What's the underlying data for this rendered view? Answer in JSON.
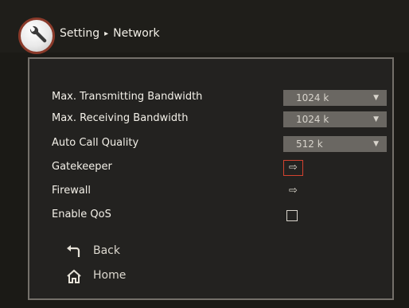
{
  "header": {
    "icon": "wrench-icon",
    "breadcrumb": [
      "Setting",
      "Network"
    ],
    "separator": "▸"
  },
  "settings": [
    {
      "label": "Max. Transmitting Bandwidth",
      "control": "select",
      "value": "1024 k"
    },
    {
      "label": "Max. Receiving Bandwidth",
      "control": "select",
      "value": "1024 k"
    },
    {
      "label": "Auto Call Quality",
      "control": "select",
      "value": "512 k"
    },
    {
      "label": "Gatekeeper",
      "control": "arrow",
      "value": "⇨",
      "focused": true
    },
    {
      "label": "Firewall",
      "control": "arrow",
      "value": "⇨",
      "focused": false
    },
    {
      "label": "Enable QoS",
      "control": "checkbox",
      "checked": false
    }
  ],
  "nav": {
    "back": {
      "label": "Back",
      "icon": "back-arrow-icon"
    },
    "home": {
      "label": "Home",
      "icon": "home-icon"
    }
  },
  "colors": {
    "background": "#1b1a16",
    "panel_border": "#74706a",
    "select_bg": "#6a6762",
    "focus_border": "#d3422f",
    "logo_ring": "#8a3a2a"
  }
}
